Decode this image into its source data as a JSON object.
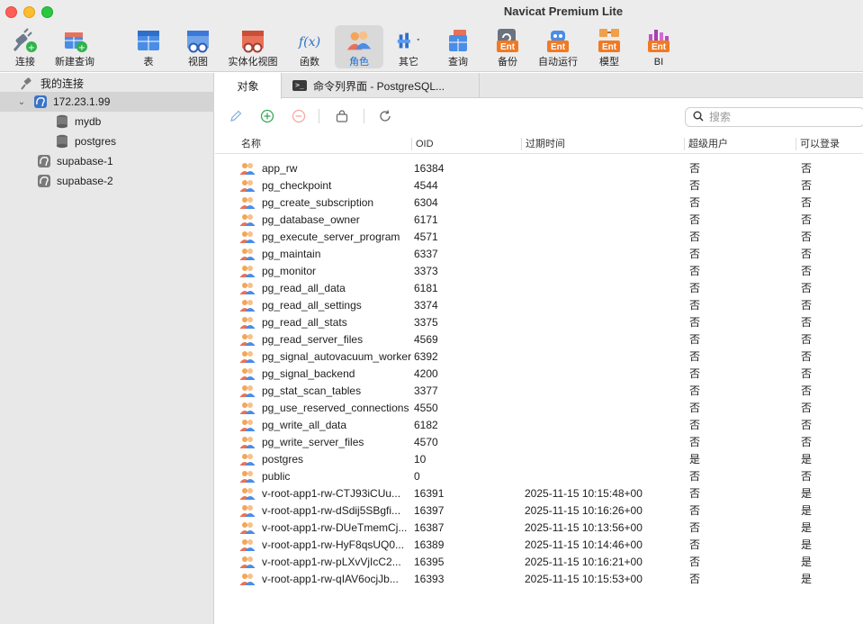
{
  "window": {
    "title": "Navicat Premium Lite"
  },
  "toolbar": {
    "items": [
      {
        "label": "连接",
        "icon": "plug-icon"
      },
      {
        "label": "新建查询",
        "icon": "new-query-icon"
      },
      {
        "label": "表",
        "icon": "table-icon"
      },
      {
        "label": "视图",
        "icon": "view-icon"
      },
      {
        "label": "实体化视图",
        "icon": "materialized-view-icon"
      },
      {
        "label": "函数",
        "icon": "function-icon"
      },
      {
        "label": "角色",
        "icon": "role-icon"
      },
      {
        "label": "其它",
        "icon": "tools-icon"
      },
      {
        "label": "查询",
        "icon": "query-icon"
      },
      {
        "label": "备份",
        "icon": "backup-icon"
      },
      {
        "label": "自动运行",
        "icon": "automation-icon"
      },
      {
        "label": "模型",
        "icon": "model-icon"
      },
      {
        "label": "BI",
        "icon": "bi-icon"
      }
    ],
    "active": "角色",
    "ent_badge": "Ent",
    "fx_glyph": "f(x)"
  },
  "sidebar": {
    "header": "我的连接",
    "connection": "172.23.1.99",
    "databases": [
      "mydb",
      "postgres"
    ],
    "other_connections": [
      "supabase-1",
      "supabase-2"
    ]
  },
  "tabs": [
    {
      "label": "对象"
    },
    {
      "label": "命令列界面 - PostgreSQL..."
    }
  ],
  "search": {
    "placeholder": "搜索"
  },
  "table": {
    "columns": [
      "名称",
      "OID",
      "过期时间",
      "超级用户",
      "可以登录"
    ],
    "rows": [
      [
        "app_rw",
        "16384",
        "",
        "否",
        "否"
      ],
      [
        "pg_checkpoint",
        "4544",
        "",
        "否",
        "否"
      ],
      [
        "pg_create_subscription",
        "6304",
        "",
        "否",
        "否"
      ],
      [
        "pg_database_owner",
        "6171",
        "",
        "否",
        "否"
      ],
      [
        "pg_execute_server_program",
        "4571",
        "",
        "否",
        "否"
      ],
      [
        "pg_maintain",
        "6337",
        "",
        "否",
        "否"
      ],
      [
        "pg_monitor",
        "3373",
        "",
        "否",
        "否"
      ],
      [
        "pg_read_all_data",
        "6181",
        "",
        "否",
        "否"
      ],
      [
        "pg_read_all_settings",
        "3374",
        "",
        "否",
        "否"
      ],
      [
        "pg_read_all_stats",
        "3375",
        "",
        "否",
        "否"
      ],
      [
        "pg_read_server_files",
        "4569",
        "",
        "否",
        "否"
      ],
      [
        "pg_signal_autovacuum_worker",
        "6392",
        "",
        "否",
        "否"
      ],
      [
        "pg_signal_backend",
        "4200",
        "",
        "否",
        "否"
      ],
      [
        "pg_stat_scan_tables",
        "3377",
        "",
        "否",
        "否"
      ],
      [
        "pg_use_reserved_connections",
        "4550",
        "",
        "否",
        "否"
      ],
      [
        "pg_write_all_data",
        "6182",
        "",
        "否",
        "否"
      ],
      [
        "pg_write_server_files",
        "4570",
        "",
        "否",
        "否"
      ],
      [
        "postgres",
        "10",
        "",
        "是",
        "是"
      ],
      [
        "public",
        "0",
        "",
        "否",
        "否"
      ],
      [
        "v-root-app1-rw-CTJ93iCUu...",
        "16391",
        "2025-11-15 10:15:48+00",
        "否",
        "是"
      ],
      [
        "v-root-app1-rw-dSdij5SBgfi...",
        "16397",
        "2025-11-15 10:16:26+00",
        "否",
        "是"
      ],
      [
        "v-root-app1-rw-DUeTmemCj...",
        "16387",
        "2025-11-15 10:13:56+00",
        "否",
        "是"
      ],
      [
        "v-root-app1-rw-HyF8qsUQ0...",
        "16389",
        "2025-11-15 10:14:46+00",
        "否",
        "是"
      ],
      [
        "v-root-app1-rw-pLXvVjIcC2...",
        "16395",
        "2025-11-15 10:16:21+00",
        "否",
        "是"
      ],
      [
        "v-root-app1-rw-qIAV6ocjJb...",
        "16393",
        "2025-11-15 10:15:53+00",
        "否",
        "是"
      ]
    ]
  },
  "colors": {
    "accent": "#1a6fd1",
    "sidebar_bg": "#e8e8e8",
    "toolbar_bg": "#ececec"
  }
}
